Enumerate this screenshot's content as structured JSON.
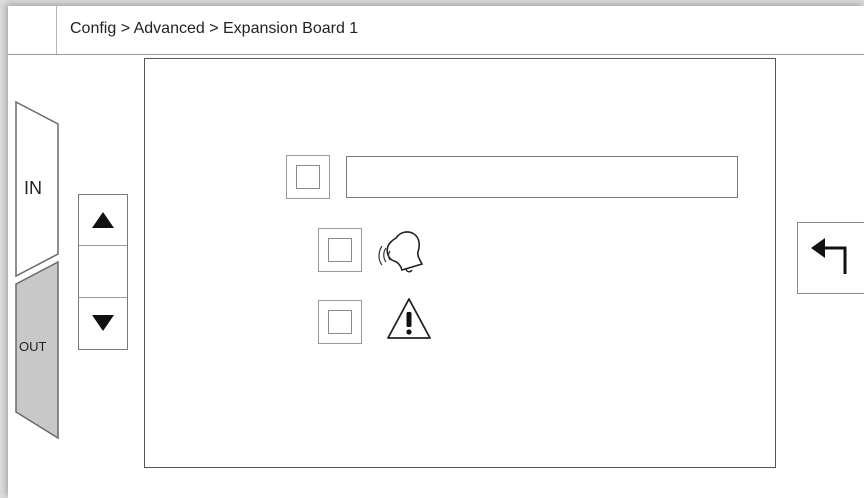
{
  "header": {
    "breadcrumb": "Config > Advanced > Expansion Board 1"
  },
  "tabs": [
    {
      "label": "IN",
      "selected": false
    },
    {
      "label": "OUT",
      "selected": true
    }
  ],
  "scroll": {
    "up_icon": "triangle-up-icon",
    "down_icon": "triangle-down-icon"
  },
  "main": {
    "enable_checkbox": {
      "checked": false
    },
    "name_field": {
      "value": "",
      "placeholder": ""
    },
    "options": [
      {
        "icon": "bell-icon",
        "checked": false
      },
      {
        "icon": "warning-icon",
        "checked": false
      }
    ]
  },
  "back_button": {
    "icon": "back-arrow-icon"
  },
  "colors": {
    "tab_selected": "#c8c8c8",
    "tab_unselected": "#ffffff",
    "border": "#555555",
    "screen_bg": "#ffffff"
  }
}
